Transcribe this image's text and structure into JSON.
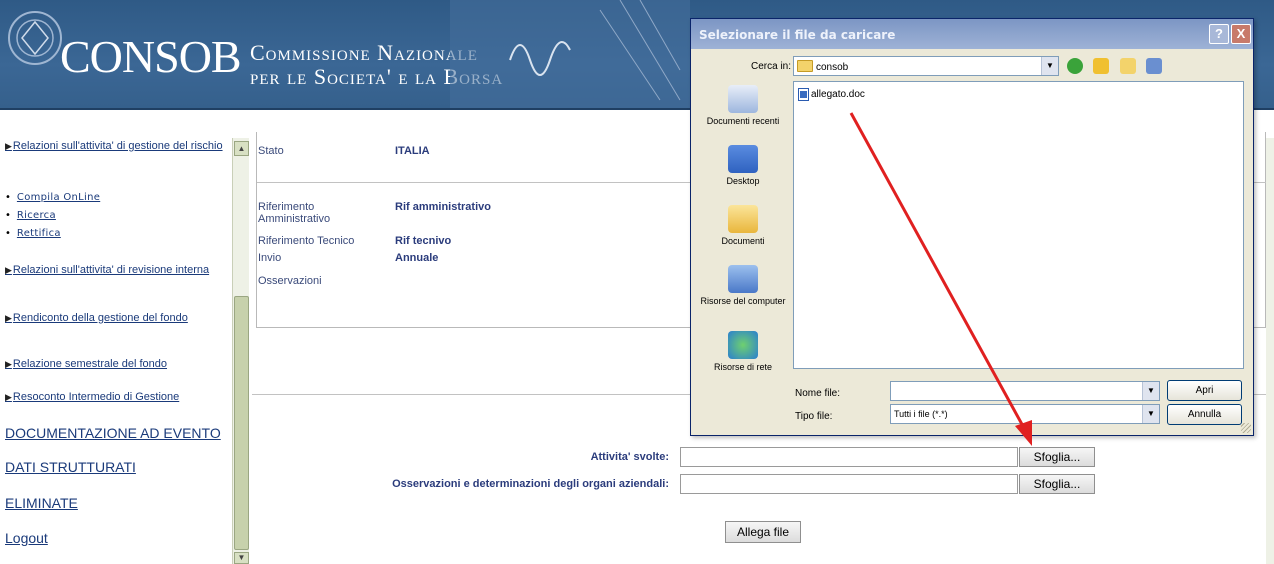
{
  "banner": {
    "logo_word": "CONSOB",
    "subtitle_line1": "Commissione Nazionale",
    "subtitle_line2": "per le Societa' e la Borsa"
  },
  "nav": {
    "items": [
      {
        "label": "Relazioni sull'attivita' di gestione del rischio"
      },
      {
        "label": "Relazioni sull'attivita' di revisione interna"
      },
      {
        "label": "Rendiconto della gestione del fondo"
      },
      {
        "label": "Relazione semestrale del fondo"
      },
      {
        "label": "Resoconto Intermedio di Gestione"
      }
    ],
    "bullets": [
      "Compila OnLine",
      "Ricerca",
      "Rettifica"
    ],
    "big_links": [
      "DOCUMENTAZIONE AD EVENTO",
      "DATI STRUTTURATI",
      "ELIMINATE",
      "Logout"
    ]
  },
  "details": {
    "stato_label": "Stato",
    "stato_value": "ITALIA",
    "rif_amm_label": "Riferimento Amministrativo",
    "rif_amm_value": "Rif amministrativo",
    "rif_tec_label": "Riferimento Tecnico",
    "rif_tec_value": "Rif tecnivo",
    "invio_label": "Invio",
    "invio_value": "Annuale",
    "osservazioni_label": "Osservazioni"
  },
  "upload": {
    "attivita_label": "Attivita' svolte:",
    "osservazioni_label": "Osservazioni e determinazioni degli organi aziendali:",
    "browse_label": "Sfoglia...",
    "attach_label": "Allega file"
  },
  "dialog": {
    "title": "Selezionare il file da caricare",
    "help": "?",
    "close": "X",
    "look_in_label": "Cerca in:",
    "look_in_value": "consob",
    "places": [
      "Documenti recenti",
      "Desktop",
      "Documenti",
      "Risorse del computer",
      "Risorse di rete"
    ],
    "file_name": "allegato.doc",
    "filename_label": "Nome file:",
    "filetype_label": "Tipo file:",
    "filetype_value": "Tutti i file (*.*)",
    "open_label": "Apri",
    "cancel_label": "Annulla"
  },
  "colors": {
    "banner": "#3b6795",
    "link": "#1a3a7a",
    "arrow": "#e02020",
    "dialog_bg": "#ece9d8"
  }
}
